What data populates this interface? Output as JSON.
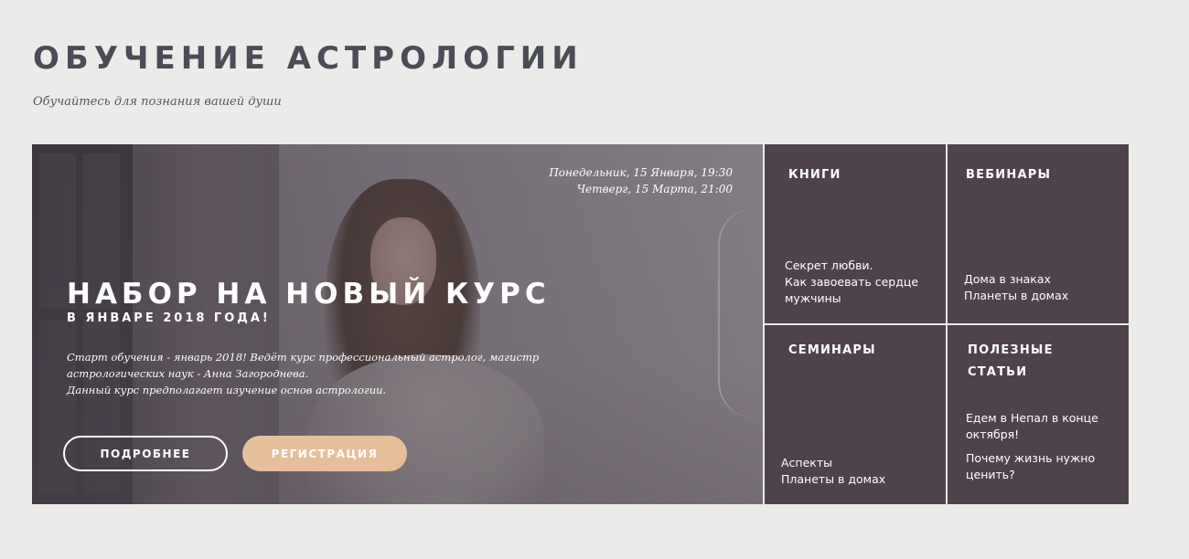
{
  "header": {
    "title": "ОБУЧЕНИЕ АСТРОЛОГИИ",
    "subtitle": "Обучайтесь для познания вашей души"
  },
  "hero": {
    "dates": [
      "Понедельник, 15 Января, 19:30",
      "Четверг, 15 Марта, 21:00"
    ],
    "headline": "НАБОР НА НОВЫЙ КУРС",
    "subheadline": "В ЯНВАРЕ 2018 ГОДА!",
    "description": [
      "Старт обучения - январь 2018! Ведёт курс профессиональный астролог, магистр",
      "астрологических наук - Анна Загороднева.",
      "Данный курс предполагает изучение основ астрологии."
    ],
    "more_button": "ПОДРОБНЕЕ",
    "register_button": "РЕГИСТРАЦИЯ"
  },
  "tiles": {
    "books": {
      "title": "КНИГИ",
      "items": [
        "Секрет любви.",
        "Как завоевать сердце",
        "мужчины"
      ]
    },
    "webinars": {
      "title": "ВЕБИНАРЫ",
      "items": [
        "Дома в знаках",
        "Планеты в домах"
      ]
    },
    "seminars": {
      "title": "СЕМИНАРЫ",
      "items": [
        "Аспекты",
        "Планеты в домах"
      ]
    },
    "articles": {
      "title_lines": [
        "ПОЛЕЗНЫЕ",
        "СТАТЬИ"
      ],
      "items": [
        [
          "Едем в Непал в конце",
          "октября!"
        ],
        [
          "Почему жизнь нужно",
          "ценить?"
        ]
      ]
    }
  },
  "colors": {
    "background": "#ecebe9",
    "title": "#4a4d56",
    "tile": "#4e434b",
    "register_button": "#e6bf9a"
  }
}
